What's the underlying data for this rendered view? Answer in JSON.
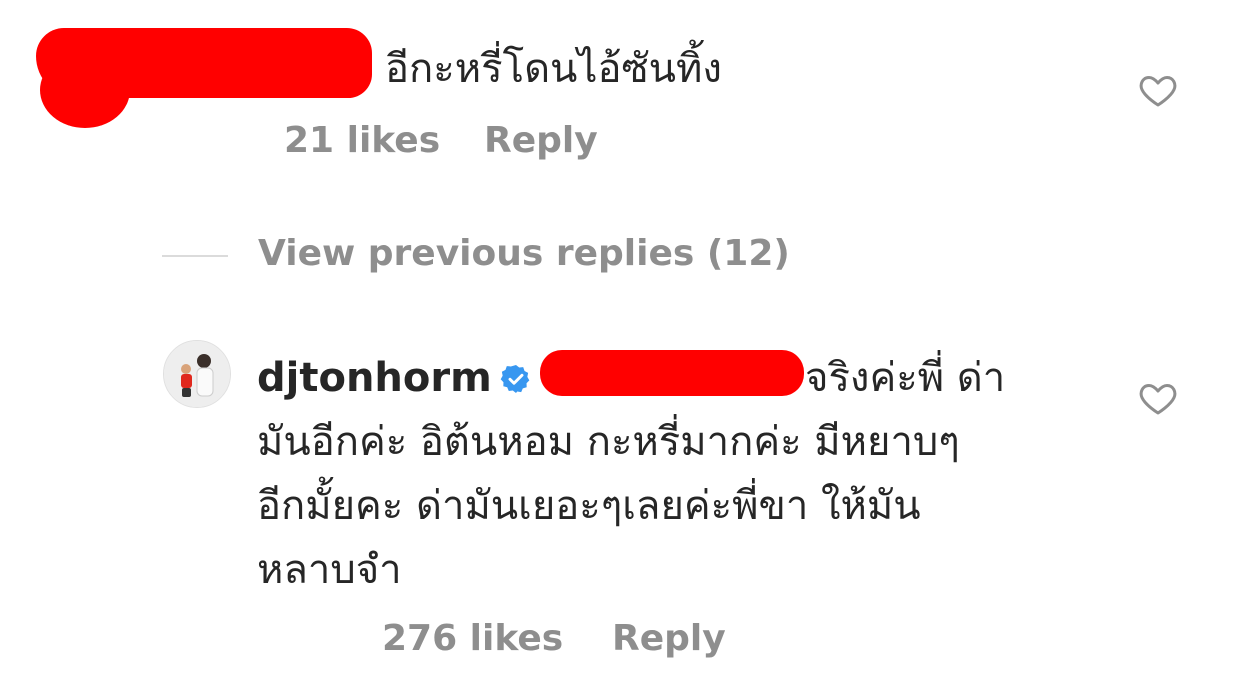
{
  "comment1": {
    "text": "อีกะหรี่โดนไอ้ซันทิ้ง",
    "likes": "21 likes",
    "reply": "Reply"
  },
  "view_previous": "View previous replies (12)",
  "comment2": {
    "username": "djtonhorm",
    "lines": [
      "จริงค่ะพี่ ด่า",
      "มันอีกค่ะ อิต้นหอม กะหรี่มากค่ะ มีหยาบๆ",
      "อีกมั้ยคะ ด่ามันเยอะๆเลยค่ะพี่ขา ให้มัน",
      "หลาบจำ"
    ],
    "likes": "276 likes",
    "reply": "Reply"
  },
  "colors": {
    "text": "#262626",
    "meta": "#8e8e8e",
    "verified": "#3897f0",
    "redaction": "#ff0000",
    "divider": "#dbdbdb"
  },
  "icons": {
    "like": "heart-outline-icon",
    "verified": "verified-badge-icon"
  }
}
